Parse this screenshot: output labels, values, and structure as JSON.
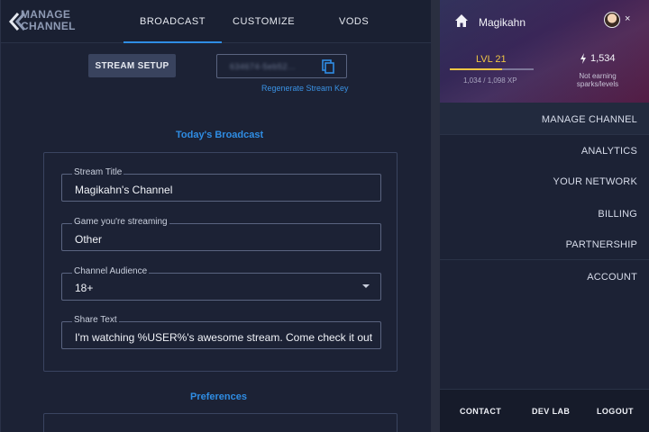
{
  "header": {
    "brand_line1": "MANAGE",
    "brand_line2": "CHANNEL",
    "tabs": [
      {
        "label": "BROADCAST"
      },
      {
        "label": "CUSTOMIZE"
      },
      {
        "label": "VODS"
      }
    ],
    "active_tab": "BROADCAST"
  },
  "stream_setup": {
    "button_label": "STREAM SETUP",
    "key_masked": "634674-5eb52…",
    "regenerate_label": "Regenerate Stream Key"
  },
  "broadcast": {
    "section_title": "Today's Broadcast",
    "fields": [
      {
        "label": "Stream Title",
        "value": "Magikahn's Channel"
      },
      {
        "label": "Game you're streaming",
        "value": "Other"
      },
      {
        "label": "Channel Audience",
        "value": "18+"
      },
      {
        "label": "Share Text",
        "value": "I'm watching %USER%'s awesome stream. Come check it out"
      }
    ]
  },
  "preferences": {
    "section_title": "Preferences"
  },
  "profile": {
    "username": "Magikahn",
    "level_label": "LVL 21",
    "xp_text": "1,034 / 1,098 XP",
    "xp_fraction": 0.62,
    "sparks": "1,534",
    "spark_note": "Not earning sparks/levels",
    "close_label": "×"
  },
  "menu": {
    "items": [
      {
        "label": "MANAGE CHANNEL"
      },
      {
        "label": "ANALYTICS"
      },
      {
        "label": "YOUR NETWORK"
      },
      {
        "label": "BILLING"
      },
      {
        "label": "PARTNERSHIP"
      },
      {
        "label": "ACCOUNT"
      }
    ],
    "active_item": "MANAGE CHANNEL"
  },
  "footer": {
    "links": [
      {
        "label": "CONTACT"
      },
      {
        "label": "DEV LAB"
      },
      {
        "label": "LOGOUT"
      }
    ]
  },
  "colors": {
    "accent": "#2f8de4",
    "level": "#f0c644",
    "background": "#1c2235"
  },
  "icons": [
    "back-chevrons-icon",
    "copy-icon",
    "chevron-down-icon",
    "home-icon",
    "lightning-icon",
    "close-icon"
  ]
}
